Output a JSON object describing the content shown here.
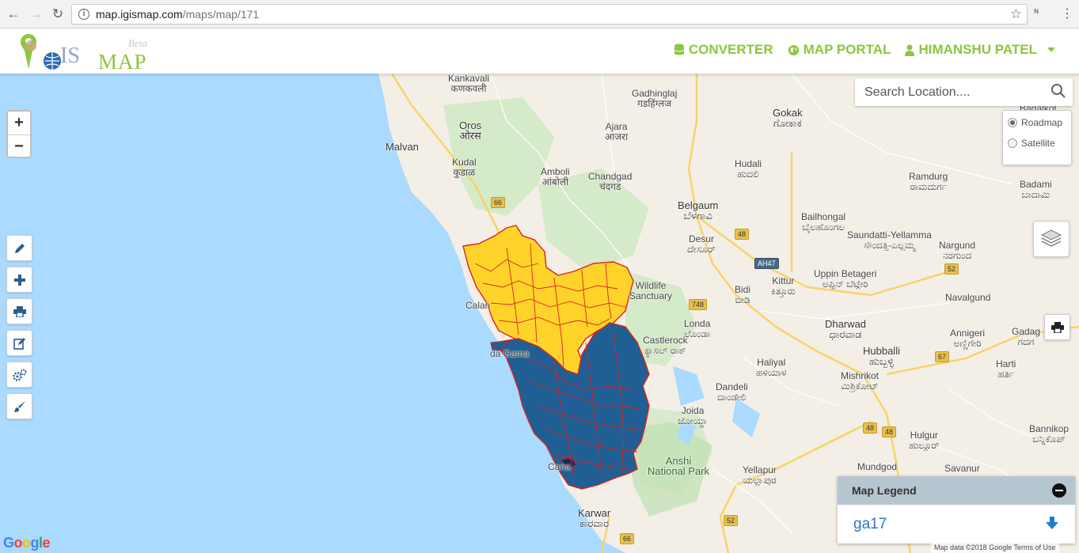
{
  "browser": {
    "url_host": "map.igismap.com",
    "url_path": "/maps/map/171"
  },
  "header": {
    "logo_is": "IS",
    "logo_map": "MAP",
    "logo_beta": "Beta",
    "nav": [
      {
        "label": "CONVERTER",
        "icon": "database-icon"
      },
      {
        "label": "MAP PORTAL",
        "icon": "globe-icon"
      },
      {
        "label": "HIMANSHU PATEL",
        "icon": "user-icon"
      }
    ]
  },
  "map": {
    "zoom_in": "+",
    "zoom_out": "−",
    "search_placeholder": "Search Location....",
    "basemap_options": [
      {
        "label": "Roadmap",
        "selected": true
      },
      {
        "label": "Satellite",
        "selected": false
      }
    ],
    "tools": [
      "pencil-icon",
      "plus-icon",
      "print-icon",
      "edit-icon",
      "gears-icon",
      "brush-icon"
    ],
    "legend": {
      "title": "Map Legend",
      "items": [
        {
          "label": "ga17"
        }
      ]
    },
    "google": "Google",
    "attribution": "Map data ©2018 Google   Terms of Use",
    "places": [
      {
        "name": "Kankavali",
        "local": "कणकवली"
      },
      {
        "name": "Gadhinglaj",
        "local": "गडहिंग्लज"
      },
      {
        "name": "Gokak",
        "local": "ಗೋಕಾಕ"
      },
      {
        "name": "Oros",
        "local": "ओरस"
      },
      {
        "name": "Ajara",
        "local": "आजरा"
      },
      {
        "name": "Malvan",
        "local": ""
      },
      {
        "name": "Hudali",
        "local": "ಹುದಲಿ"
      },
      {
        "name": "Kudal",
        "local": "कुडाळ"
      },
      {
        "name": "Amboli",
        "local": "आंबोली"
      },
      {
        "name": "Chandgad",
        "local": "चंदगड"
      },
      {
        "name": "Ramdurg",
        "local": "ರಾಮದುರ್ಗ"
      },
      {
        "name": "Badami",
        "local": "ಬಾದಾಮಿ"
      },
      {
        "name": "Belgaum",
        "local": "ಬೆಳಗಾವಿ"
      },
      {
        "name": "Bailhongal",
        "local": "ಬೈಲಹೊಂಗಲ"
      },
      {
        "name": "Desur",
        "local": "ದೇಸೂರ್"
      },
      {
        "name": "Saundatti-Yellamma",
        "local": "ಸೌಂದತ್ತಿ-ಎಲ್ಲಮ್ಮ"
      },
      {
        "name": "Nargund",
        "local": "ನರಗುಂದ"
      },
      {
        "name": "Uppin Betageri",
        "local": "ಅಪ್ಪಿನ್ ಬೆಟ್ಗೇರಿ"
      },
      {
        "name": "Kittur",
        "local": "ಕಿತ್ತೂರು"
      },
      {
        "name": "Bidi",
        "local": "ಬೀಡಿ"
      },
      {
        "name": "Navalgund",
        "local": ""
      },
      {
        "name": "Londa",
        "local": "ಲೊಂಡಾ"
      },
      {
        "name": "Dharwad",
        "local": "ಧಾರವಾಡ"
      },
      {
        "name": "Annigeri",
        "local": "ಅಣ್ಣಿಗೇರಿ"
      },
      {
        "name": "Gadag",
        "local": "ಗದಗ"
      },
      {
        "name": "Castlerock",
        "local": "ಕ್ಯಾಸಲ್ ರಾಕ್"
      },
      {
        "name": "Hubballi",
        "local": "ಹುಬ್ಬಳ್ಳಿ"
      },
      {
        "name": "Haliyal",
        "local": "ಹಳಿಯಾಳ"
      },
      {
        "name": "Harti",
        "local": "ಹರ್ತಿ"
      },
      {
        "name": "Mishrikot",
        "local": "ಮಿಶ್ರಿಕೋಟ್"
      },
      {
        "name": "Dandeli",
        "local": "ದಾಂಡೇಲಿ"
      },
      {
        "name": "Joida",
        "local": "ಜೋಯ್ಡಾ"
      },
      {
        "name": "Hulgur",
        "local": "ಹುಲ್ಗೂರ್"
      },
      {
        "name": "Bannikop",
        "local": "ಬನ್ನಿಕೊಪ್"
      },
      {
        "name": "Anshi",
        "local": "National Park"
      },
      {
        "name": "Yellapur",
        "local": "ಯಲ್ಲಾಪುರ"
      },
      {
        "name": "Mundgod",
        "local": ""
      },
      {
        "name": "Savanur",
        "local": ""
      },
      {
        "name": "Karwar",
        "local": "ಕಾರವಾರ"
      },
      {
        "name": "Bagalkot",
        "local": ""
      },
      {
        "name": "Calan",
        "local": ""
      },
      {
        "name": "da Gama",
        "local": ""
      },
      {
        "name": "Cana",
        "local": ""
      },
      {
        "name": "Wildlife",
        "local": "Sanctuary"
      }
    ],
    "road_shields": [
      "66",
      "48",
      "48",
      "AH47",
      "748",
      "52",
      "67",
      "48",
      "52",
      "66"
    ]
  }
}
